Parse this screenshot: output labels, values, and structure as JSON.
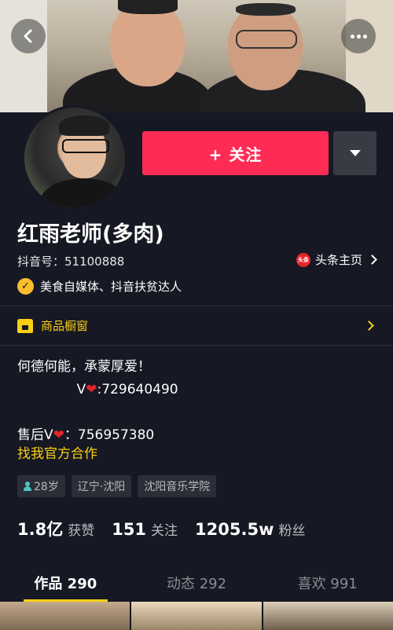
{
  "header": {
    "back_icon": "chevron-left-icon",
    "more_icon": "more-dots-icon"
  },
  "profile": {
    "follow_label": "+ 关注",
    "name": "红雨老师(多肉)",
    "douyin_id": "抖音号：51100888",
    "toutiao_icon_text": "头条",
    "toutiao_label": "头条主页",
    "verification": "美食自媒体、抖音扶贫达人"
  },
  "shop": {
    "label": "商品橱窗"
  },
  "bio": {
    "line1": "何德何能，承蒙厚爱！",
    "line2_prefix": "              V",
    "line2_suffix": ":729640490",
    "line4_prefix": "售后V",
    "line4_suffix": "：756957380",
    "link": "找我官方合作"
  },
  "tags": {
    "age": "28岁",
    "location": "辽宁·沈阳",
    "school": "沈阳音乐学院"
  },
  "stats": {
    "likes_value": "1.8亿",
    "likes_label": "获赞",
    "following_value": "151",
    "following_label": "关注",
    "followers_value": "1205.5w",
    "followers_label": "粉丝"
  },
  "tabs": [
    {
      "label": "作品 290"
    },
    {
      "label": "动态 292"
    },
    {
      "label": "喜欢 991"
    }
  ],
  "colors": {
    "background": "#161823",
    "follow_button": "#fe2c55",
    "accent_yellow": "#face15"
  }
}
